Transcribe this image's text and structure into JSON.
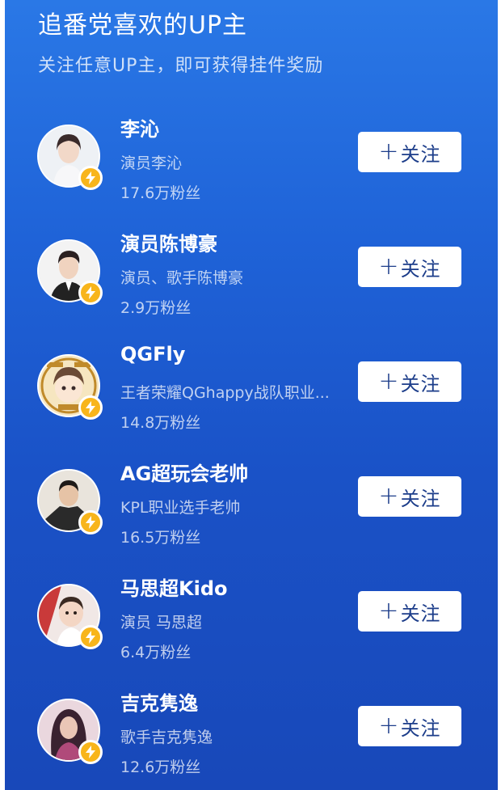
{
  "header": {
    "title": "追番党喜欢的UP主",
    "subtitle": "关注任意UP主，即可获得挂件奖励"
  },
  "colors": {
    "panel_top": "#2a78e6",
    "panel_bottom": "#1848b9",
    "badge": "#f8b51b",
    "button_text": "#1c3d8a"
  },
  "follow_button": {
    "plus": "+",
    "label": "关注"
  },
  "users": [
    {
      "name": "李沁",
      "desc": "演员李沁",
      "fans": "17.6万粉丝",
      "avatar_icon": "portrait-woman-icon"
    },
    {
      "name": "演员陈博豪",
      "desc": "演员、歌手陈博豪",
      "fans": "2.9万粉丝",
      "avatar_icon": "portrait-man-icon"
    },
    {
      "name": "QGFly",
      "desc": "王者荣耀QGhappy战队职业...",
      "fans": "14.8万粉丝",
      "avatar_icon": "cartoon-avatar-icon"
    },
    {
      "name": "AG超玩会老帅",
      "desc": "KPL职业选手老帅",
      "fans": "16.5万粉丝",
      "avatar_icon": "portrait-man-icon"
    },
    {
      "name": "马思超Kido",
      "desc": "演员 马思超",
      "fans": "6.4万粉丝",
      "avatar_icon": "portrait-child-icon"
    },
    {
      "name": "吉克隽逸",
      "desc": "歌手吉克隽逸",
      "fans": "12.6万粉丝",
      "avatar_icon": "portrait-woman-icon"
    }
  ]
}
